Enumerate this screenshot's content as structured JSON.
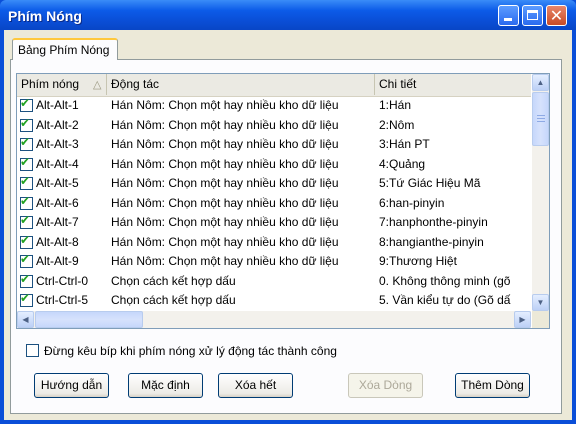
{
  "window": {
    "title": "Phím Nóng"
  },
  "tabs": [
    {
      "label": "Bảng Phím Nóng"
    }
  ],
  "table": {
    "columns": [
      "Phím nóng",
      "Động tác",
      "Chi tiết"
    ],
    "rows": [
      {
        "checked": true,
        "key": "Alt-Alt-1",
        "action": "Hán Nôm: Chọn một hay nhiều kho dữ liệu",
        "detail": "1:Hán"
      },
      {
        "checked": true,
        "key": "Alt-Alt-2",
        "action": "Hán Nôm: Chọn một hay nhiều kho dữ liệu",
        "detail": "2:Nôm"
      },
      {
        "checked": true,
        "key": "Alt-Alt-3",
        "action": "Hán Nôm: Chọn một hay nhiều kho dữ liệu",
        "detail": "3:Hán PT"
      },
      {
        "checked": true,
        "key": "Alt-Alt-4",
        "action": "Hán Nôm: Chọn một hay nhiều kho dữ liệu",
        "detail": "4:Quảng"
      },
      {
        "checked": true,
        "key": "Alt-Alt-5",
        "action": "Hán Nôm: Chọn một hay nhiều kho dữ liệu",
        "detail": "5:Tứ Giác Hiệu Mã"
      },
      {
        "checked": true,
        "key": "Alt-Alt-6",
        "action": "Hán Nôm: Chọn một hay nhiều kho dữ liệu",
        "detail": "6:han-pinyin"
      },
      {
        "checked": true,
        "key": "Alt-Alt-7",
        "action": "Hán Nôm: Chọn một hay nhiều kho dữ liệu",
        "detail": "7:hanphonthe-pinyin"
      },
      {
        "checked": true,
        "key": "Alt-Alt-8",
        "action": "Hán Nôm: Chọn một hay nhiều kho dữ liệu",
        "detail": "8:hangianthe-pinyin"
      },
      {
        "checked": true,
        "key": "Alt-Alt-9",
        "action": "Hán Nôm: Chọn một hay nhiều kho dữ liệu",
        "detail": "9:Thương Hiệt"
      },
      {
        "checked": true,
        "key": "Ctrl-Ctrl-0",
        "action": "Chọn cách kết hợp dấu",
        "detail": "0. Không thông minh (gõ"
      },
      {
        "checked": true,
        "key": "Ctrl-Ctrl-5",
        "action": "Chọn cách kết hợp dấu",
        "detail": "5. Vần kiểu tự do (Gõ dấ"
      }
    ]
  },
  "options": {
    "no_beep_label": "Đừng kêu bíp khi phím nóng xử lý động tác thành công",
    "no_beep_checked": false
  },
  "buttons": {
    "guide": "Hướng dẫn",
    "default": "Mặc định",
    "delete_all": "Xóa hết",
    "delete_row": "Xóa Dòng",
    "add_row": "Thêm Dòng"
  },
  "colors": {
    "titlebar": "#0A4ED8",
    "dialog_bg": "#ECE9D8",
    "check": "#21A121",
    "tab_highlight": "#FFC83C"
  }
}
